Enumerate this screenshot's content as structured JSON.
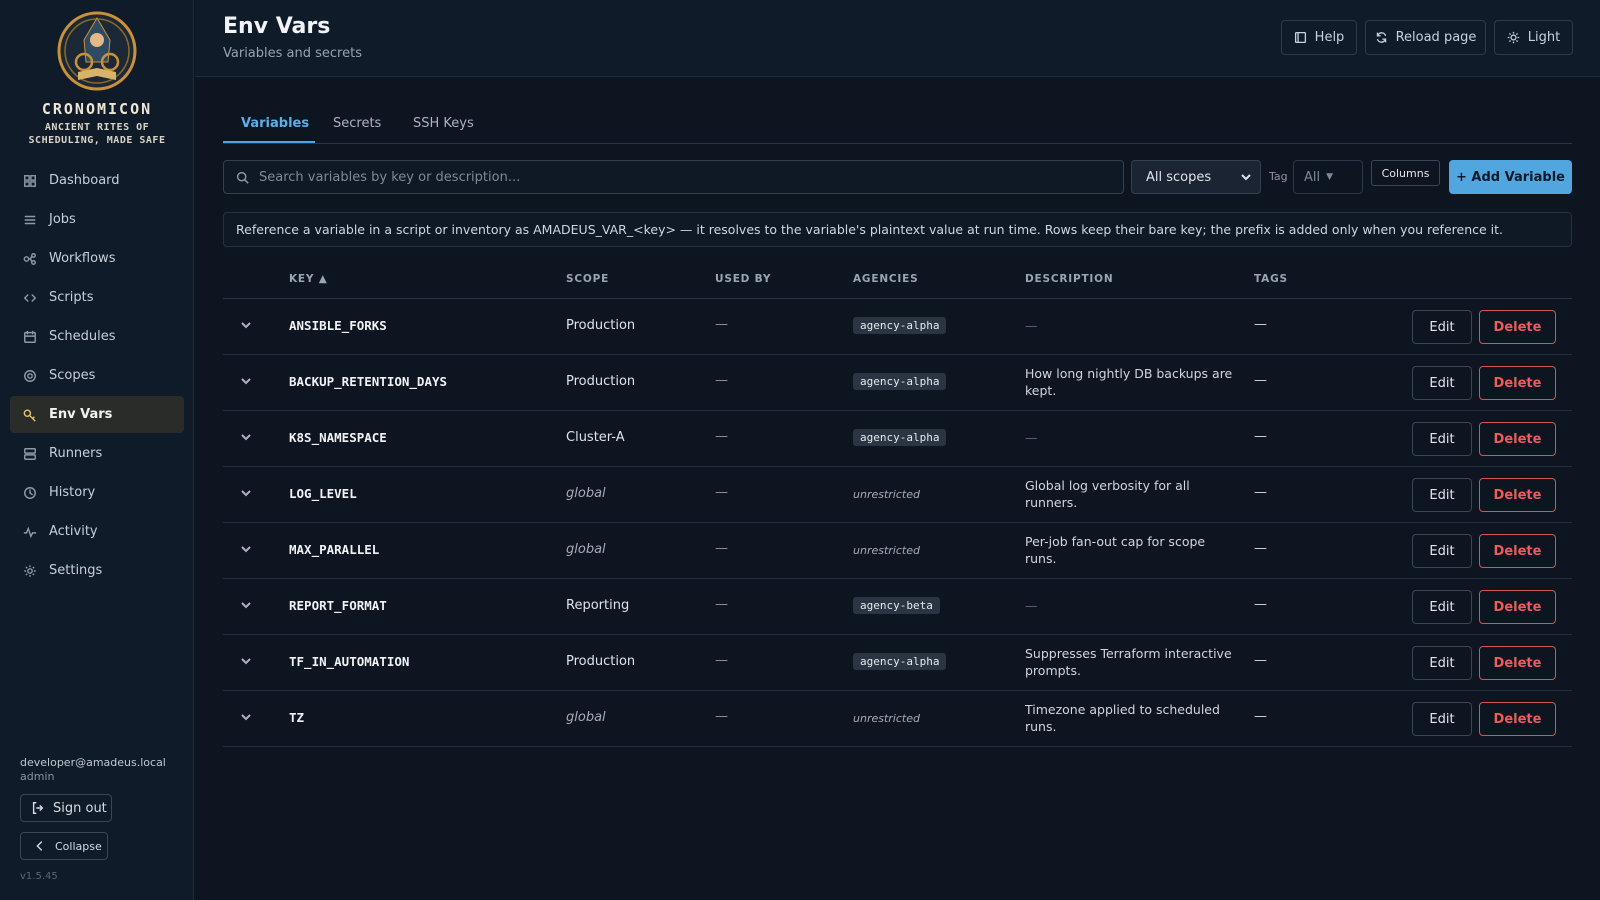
{
  "brand": {
    "name": "CRONOMICON",
    "tagline": "ANCIENT RITES OF SCHEDULING, MADE SAFE"
  },
  "sidebar": {
    "items": [
      {
        "label": "Dashboard",
        "icon": "grid-icon"
      },
      {
        "label": "Jobs",
        "icon": "list-icon"
      },
      {
        "label": "Workflows",
        "icon": "workflow-icon"
      },
      {
        "label": "Scripts",
        "icon": "code-icon"
      },
      {
        "label": "Schedules",
        "icon": "calendar-icon"
      },
      {
        "label": "Scopes",
        "icon": "target-icon"
      },
      {
        "label": "Env Vars",
        "icon": "key-icon",
        "active": true
      },
      {
        "label": "Runners",
        "icon": "server-icon"
      },
      {
        "label": "History",
        "icon": "clock-icon"
      },
      {
        "label": "Activity",
        "icon": "pulse-icon"
      },
      {
        "label": "Settings",
        "icon": "gear-icon"
      }
    ],
    "user_email": "developer@amadeus.local",
    "user_role": "admin",
    "sign_out": "Sign out",
    "collapse": "Collapse",
    "version": "v1.5.45"
  },
  "header": {
    "title": "Env Vars",
    "subtitle": "Variables and secrets",
    "help": "Help",
    "reload": "Reload page",
    "theme": "Light"
  },
  "tabs": [
    {
      "label": "Variables",
      "active": true
    },
    {
      "label": "Secrets"
    },
    {
      "label": "SSH Keys"
    }
  ],
  "toolbar": {
    "search_placeholder": "Search variables by key or description...",
    "scope_select": "All scopes",
    "tag_label": "Tag",
    "tag_value": "All",
    "columns": "Columns",
    "add": "+ Add Variable"
  },
  "info": "Reference a variable in a script or inventory as AMADEUS_VAR_<key> — it resolves to the variable's plaintext value at run time. Rows keep their bare key; the prefix is added only when you reference it.",
  "table": {
    "headers": {
      "key": "KEY ▲",
      "scope": "SCOPE",
      "used_by": "USED BY",
      "agencies": "AGENCIES",
      "description": "DESCRIPTION",
      "tags": "TAGS"
    },
    "edit_label": "Edit",
    "delete_label": "Delete",
    "rows": [
      {
        "key": "ANSIBLE_FORKS",
        "scope": "Production",
        "scope_global": false,
        "used_by": "—",
        "agency": "agency-alpha",
        "agency_badge": true,
        "description": "—",
        "desc_empty": true,
        "tags": "—"
      },
      {
        "key": "BACKUP_RETENTION_DAYS",
        "scope": "Production",
        "scope_global": false,
        "used_by": "—",
        "agency": "agency-alpha",
        "agency_badge": true,
        "description": "How long nightly DB backups are kept.",
        "desc_empty": false,
        "tags": "—"
      },
      {
        "key": "K8S_NAMESPACE",
        "scope": "Cluster-A",
        "scope_global": false,
        "used_by": "—",
        "agency": "agency-alpha",
        "agency_badge": true,
        "description": "—",
        "desc_empty": true,
        "tags": "—"
      },
      {
        "key": "LOG_LEVEL",
        "scope": "global",
        "scope_global": true,
        "used_by": "—",
        "agency": "unrestricted",
        "agency_badge": false,
        "description": "Global log verbosity for all runners.",
        "desc_empty": false,
        "tags": "—"
      },
      {
        "key": "MAX_PARALLEL",
        "scope": "global",
        "scope_global": true,
        "used_by": "—",
        "agency": "unrestricted",
        "agency_badge": false,
        "description": "Per-job fan-out cap for scope runs.",
        "desc_empty": false,
        "tags": "—"
      },
      {
        "key": "REPORT_FORMAT",
        "scope": "Reporting",
        "scope_global": false,
        "used_by": "—",
        "agency": "agency-beta",
        "agency_badge": true,
        "description": "—",
        "desc_empty": true,
        "tags": "—"
      },
      {
        "key": "TF_IN_AUTOMATION",
        "scope": "Production",
        "scope_global": false,
        "used_by": "—",
        "agency": "agency-alpha",
        "agency_badge": true,
        "description": "Suppresses Terraform interactive prompts.",
        "desc_empty": false,
        "tags": "—"
      },
      {
        "key": "TZ",
        "scope": "global",
        "scope_global": true,
        "used_by": "—",
        "agency": "unrestricted",
        "agency_badge": false,
        "description": "Timezone applied to scheduled runs.",
        "desc_empty": false,
        "tags": "—"
      }
    ]
  }
}
